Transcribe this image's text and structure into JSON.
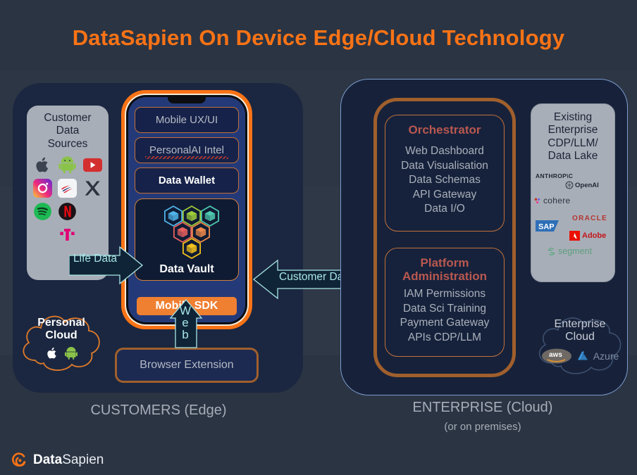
{
  "title": "DataSapien On Device Edge/Cloud Technology",
  "customers": {
    "data_sources": {
      "heading": "Customer\nData\nSources",
      "heading_lines": [
        "Customer",
        "Data",
        "Sources"
      ],
      "icons": [
        "apple-icon",
        "android-icon",
        "youtube-icon",
        "instagram-icon",
        "bank-of-america-icon",
        "x-twitter-icon",
        "spotify-icon",
        "netflix-icon",
        "t-mobile-icon"
      ]
    },
    "phone": {
      "rows": [
        {
          "label": "Mobile UX/UI",
          "style": "dim"
        },
        {
          "label": "PersonalAI Intel",
          "style": "dim-spell"
        },
        {
          "label": "Data Wallet",
          "style": "bold"
        }
      ],
      "vault_label": "Data Vault",
      "vault_hex_colors": [
        "#4fb3e8",
        "#9ccc3a",
        "#4fc9b0",
        "#e8615f",
        "#ef8a4a",
        "#f3c21c"
      ],
      "mobile_sdk_label": "Mobile SDK"
    },
    "browser_extension_label": "Browser  Extension",
    "personal_cloud": {
      "lines": [
        "Personal",
        "Cloud"
      ],
      "icons": [
        "apple-icon",
        "android-icon"
      ]
    },
    "section_label": "CUSTOMERS (Edge)"
  },
  "arrows": {
    "life_data": "Life Data",
    "customer_data": "Customer Data",
    "web": "Web",
    "web_letters": [
      "W",
      "e",
      "b"
    ]
  },
  "enterprise": {
    "orchestrator": {
      "title": "Orchestrator",
      "items": [
        "Web Dashboard",
        "Data Visualisation",
        "Data Schemas",
        "API Gateway",
        "Data I/O"
      ]
    },
    "platform_administration": {
      "title_lines": [
        "Platform",
        "Administration"
      ],
      "items": [
        "IAM Permissions",
        "Data Sci Training",
        "Payment Gateway",
        "APIs CDP/LLM"
      ]
    },
    "existing": {
      "heading_lines": [
        "Existing",
        "Enterprise",
        "CDP/LLM/",
        "Data Lake"
      ],
      "logos": [
        "ANTHROP\\C",
        "OpenAI",
        "cohere",
        "ORACLE",
        "SAP",
        "Adobe",
        "segment"
      ]
    },
    "enterprise_cloud": {
      "lines": [
        "Enterprise",
        "Cloud"
      ],
      "icons": [
        "aws-icon",
        "azure-icon"
      ]
    },
    "section_label": "ENTERPRISE (Cloud)",
    "section_sublabel": "(or on premises)"
  },
  "footer": {
    "brand_bold": "Data",
    "brand_light": "Sapien"
  },
  "colors": {
    "background": "#2b3443",
    "title_orange": "#f97316",
    "panel_dark": "#1b2740",
    "accent_brown": "#a05f2c",
    "accent_red": "#b9584f",
    "arrow_cyan": "#a8e6e6",
    "card_grey": "#a8aeb8"
  }
}
